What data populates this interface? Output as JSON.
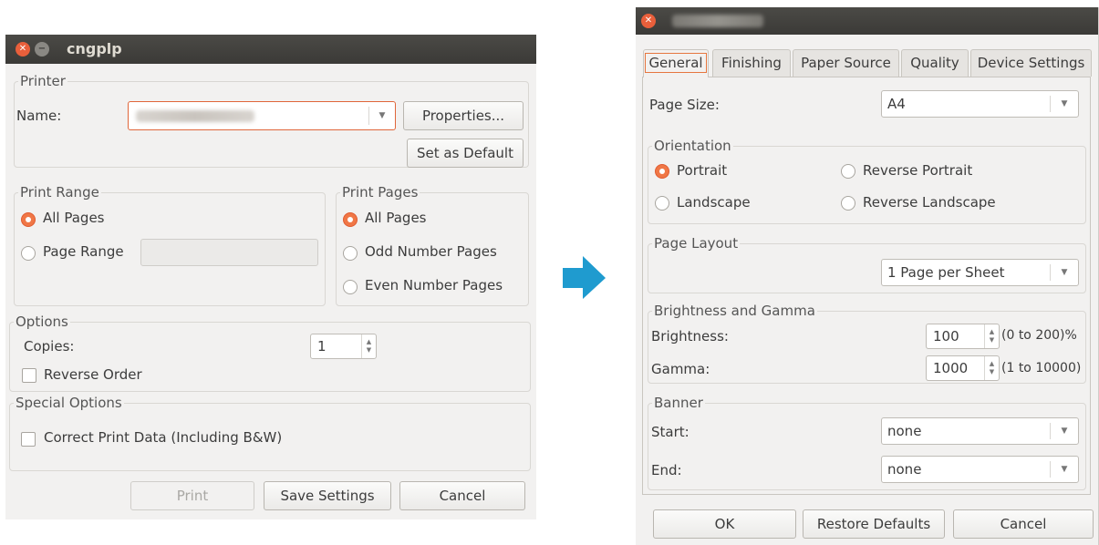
{
  "left_window": {
    "title": "cngplp",
    "printer": {
      "group_label": "Printer",
      "name_label": "Name:",
      "properties_button": "Properties...",
      "set_default_button": "Set as Default"
    },
    "print_range": {
      "group_label": "Print Range",
      "all_pages": "All Pages",
      "page_range": "Page Range",
      "selected": "All Pages"
    },
    "print_pages": {
      "group_label": "Print Pages",
      "all_pages": "All Pages",
      "odd_pages": "Odd Number Pages",
      "even_pages": "Even Number Pages",
      "selected": "All Pages"
    },
    "options": {
      "group_label": "Options",
      "copies_label": "Copies:",
      "copies_value": "1",
      "reverse_order": "Reverse Order"
    },
    "special_options": {
      "group_label": "Special Options",
      "correct_print_data": "Correct Print Data (Including B&W)"
    },
    "buttons": {
      "print": "Print",
      "save_settings": "Save Settings",
      "cancel": "Cancel"
    }
  },
  "arrow": {
    "color": "#1f9bcf"
  },
  "right_window": {
    "tabs": [
      "General",
      "Finishing",
      "Paper Source",
      "Quality",
      "Device Settings"
    ],
    "active_tab": "General",
    "page_size_label": "Page Size:",
    "page_size_value": "A4",
    "orientation": {
      "group_label": "Orientation",
      "portrait": "Portrait",
      "reverse_portrait": "Reverse Portrait",
      "landscape": "Landscape",
      "reverse_landscape": "Reverse Landscape",
      "selected": "Portrait"
    },
    "page_layout": {
      "group_label": "Page Layout",
      "value": "1 Page per Sheet"
    },
    "brightness_gamma": {
      "group_label": "Brightness and Gamma",
      "brightness_label": "Brightness:",
      "brightness_value": "100",
      "brightness_range": "(0 to 200)%",
      "gamma_label": "Gamma:",
      "gamma_value": "1000",
      "gamma_range": "(1 to 10000)"
    },
    "banner": {
      "group_label": "Banner",
      "start_label": "Start:",
      "start_value": "none",
      "end_label": "End:",
      "end_value": "none"
    },
    "buttons": {
      "ok": "OK",
      "restore_defaults": "Restore Defaults",
      "cancel": "Cancel"
    }
  },
  "colors": {
    "accent": "#f07746",
    "titlebar": "#3c3b37",
    "window_bg": "#f2f1f0"
  }
}
